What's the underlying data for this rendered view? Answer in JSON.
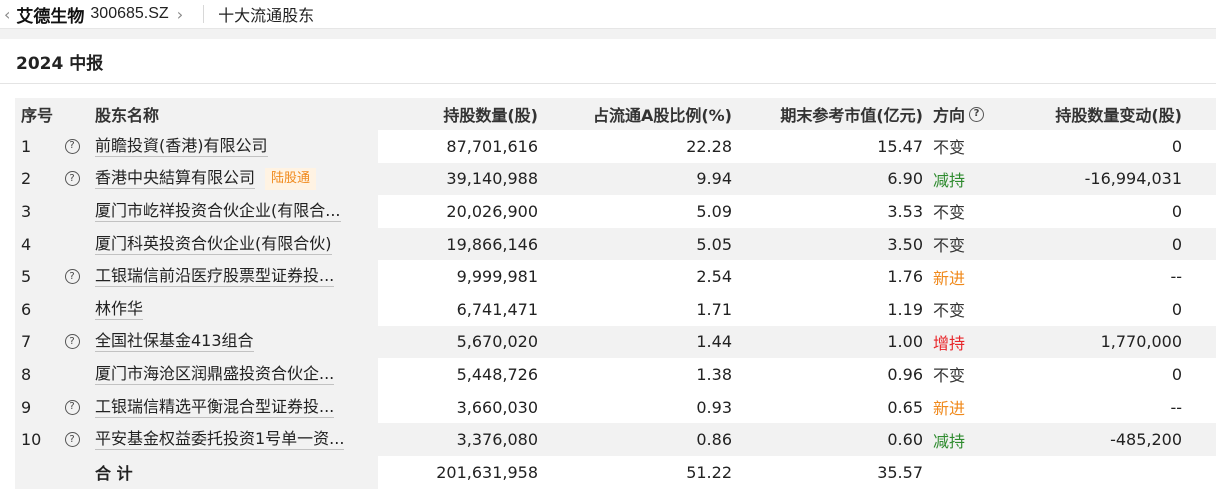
{
  "header": {
    "back_icon": "chevron-left-icon",
    "stock_name": "艾德生物",
    "stock_code": "300685.SZ",
    "forward_icon": "chevron-right-icon",
    "section_title": "十大流通股东"
  },
  "period": "2024 中报",
  "table": {
    "columns": {
      "idx": "序号",
      "name": "股东名称",
      "shares": "持股数量(股)",
      "pct": "占流通A股比例(%)",
      "value": "期末参考市值(亿元)",
      "direction": "方向",
      "change": "持股数量变动(股)"
    },
    "rows": [
      {
        "idx": "1",
        "name": "前瞻投資(香港)有限公司",
        "shares": "87,701,616",
        "pct": "22.28",
        "value": "15.47",
        "direction": "不变",
        "change": "0"
      },
      {
        "idx": "2",
        "name": "香港中央結算有限公司",
        "badge": "陆股通",
        "shares": "39,140,988",
        "pct": "9.94",
        "value": "6.90",
        "direction": "减持",
        "change": "-16,994,031"
      },
      {
        "idx": "3",
        "name": "厦门市屹祥投资合伙企业(有限合...",
        "shares": "20,026,900",
        "pct": "5.09",
        "value": "3.53",
        "direction": "不变",
        "change": "0"
      },
      {
        "idx": "4",
        "name": "厦门科英投资合伙企业(有限合伙)",
        "shares": "19,866,146",
        "pct": "5.05",
        "value": "3.50",
        "direction": "不变",
        "change": "0"
      },
      {
        "idx": "5",
        "name": "工银瑞信前沿医疗股票型证券投...",
        "shares": "9,999,981",
        "pct": "2.54",
        "value": "1.76",
        "direction": "新进",
        "change": "--"
      },
      {
        "idx": "6",
        "name": "林作华",
        "shares": "6,741,471",
        "pct": "1.71",
        "value": "1.19",
        "direction": "不变",
        "change": "0"
      },
      {
        "idx": "7",
        "name": "全国社保基金413组合",
        "shares": "5,670,020",
        "pct": "1.44",
        "value": "1.00",
        "direction": "增持",
        "change": "1,770,000"
      },
      {
        "idx": "8",
        "name": "厦门市海沧区润鼎盛投资合伙企...",
        "shares": "5,448,726",
        "pct": "1.38",
        "value": "0.96",
        "direction": "不变",
        "change": "0"
      },
      {
        "idx": "9",
        "name": "工银瑞信精选平衡混合型证券投...",
        "shares": "3,660,030",
        "pct": "0.93",
        "value": "0.65",
        "direction": "新进",
        "change": "--"
      },
      {
        "idx": "10",
        "name": "平安基金权益委托投资1号单一资...",
        "shares": "3,376,080",
        "pct": "0.86",
        "value": "0.60",
        "direction": "减持",
        "change": "-485,200"
      }
    ],
    "total": {
      "label": "合 计",
      "shares": "201,631,958",
      "pct": "51.22",
      "value": "35.57"
    }
  }
}
